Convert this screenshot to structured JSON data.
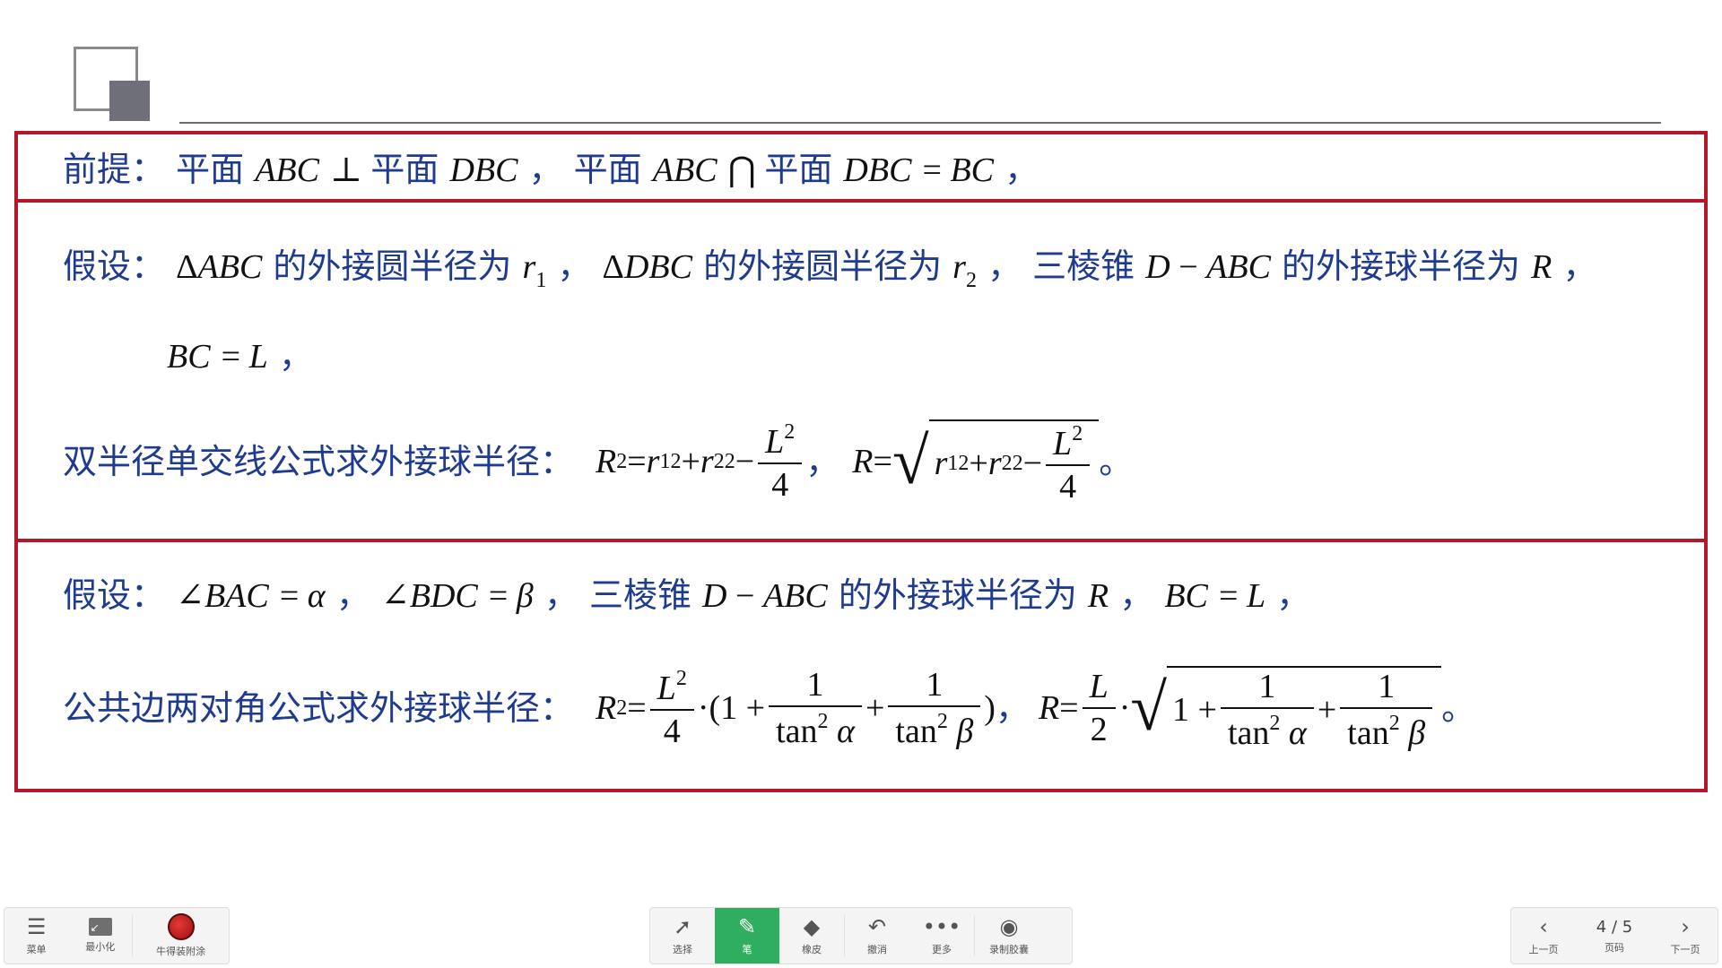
{
  "slide": {
    "premise": {
      "label": "前提：",
      "text_1": "平面",
      "math_1": "ABC",
      "perp": " ⊥ ",
      "text_2": "平面",
      "math_2": "DBC",
      "comma_1": "，",
      "text_3": "平面",
      "math_3": "ABC",
      "cap": " ⋂ ",
      "text_4": "平面",
      "math_4": "DBC",
      "eq": " = ",
      "math_5": "BC",
      "comma_2": "，"
    },
    "assumption1": {
      "label": "假设：",
      "delta_1": "Δ",
      "math_1": "ABC",
      "text_1": "的外接圆半径为",
      "r1": "r",
      "r1_sub": "1",
      "comma_1": "，",
      "delta_2": "Δ",
      "math_2": "DBC",
      "text_2": "的外接圆半径为",
      "r2": "r",
      "r2_sub": "2",
      "comma_2": "，",
      "text_3": "三棱锥",
      "math_3": "D",
      "minus": " − ",
      "math_4": "ABC",
      "text_4": "的外接球半径为",
      "math_5": "R",
      "comma_3": "，",
      "line2_math_1": "BC",
      "line2_eq": " = ",
      "line2_math_2": "L",
      "line2_comma": "，"
    },
    "formula1": {
      "label": "双半径单交线公式求外接球半径：",
      "R": "R",
      "sq": "2",
      "eq": " = ",
      "r": "r",
      "sub1": "1",
      "sub2": "2",
      "plus": " + ",
      "minus": " − ",
      "L": "L",
      "den": "4",
      "sep": "，",
      "end": "。"
    },
    "assumption2": {
      "label": "假设：",
      "angle_1": "∠",
      "math_1": "BAC",
      "eq": " = ",
      "alpha": "α",
      "comma_1": "，",
      "angle_2": "∠",
      "math_2": "BDC",
      "beta": "β",
      "comma_2": "，",
      "text_1": "三棱锥",
      "math_3": "D",
      "minus": " − ",
      "math_4": "ABC",
      "text_2": "的外接球半径为",
      "math_5": "R",
      "comma_3": "，",
      "math_6": "BC",
      "math_7": "L",
      "comma_4": "，"
    },
    "formula2": {
      "label": "公共边两对角公式求外接球半径：",
      "R": "R",
      "sq": "2",
      "eq": " = ",
      "L": "L",
      "four": "4",
      "two": "2",
      "dot": "·",
      "open": "(1 + ",
      "one": "1",
      "tan": "tan",
      "alpha": "α",
      "beta": "β",
      "plus": " + ",
      "close": ")",
      "sep": "，",
      "sqrt_one": "1 + ",
      "end": "。"
    }
  },
  "toolbar": {
    "menu_label": "菜单",
    "minimize_label": "最小化",
    "app_label": "牛得装附涂",
    "select_label": "选择",
    "pen_label": "笔",
    "eraser_label": "橡皮",
    "undo_label": "撤消",
    "more_label": "更多",
    "record_label": "录制胶囊",
    "prev_label": "上一页",
    "page_label": "页码",
    "page_value": "4 / 5",
    "next_label": "下一页",
    "icons": {
      "menu": "hamburger-icon",
      "minimize": "minimize-icon",
      "app": "app-logo",
      "select": "cursor-icon",
      "pen": "pen-icon",
      "eraser": "eraser-icon",
      "undo": "undo-icon",
      "more": "more-dots-icon",
      "record": "record-icon",
      "prev": "chevron-left-icon",
      "next": "chevron-right-icon"
    },
    "accent_color": "#2fae5f"
  },
  "colors": {
    "box_border": "#b4162a",
    "text_blue": "#1f3b8f",
    "math_black": "#111111"
  }
}
